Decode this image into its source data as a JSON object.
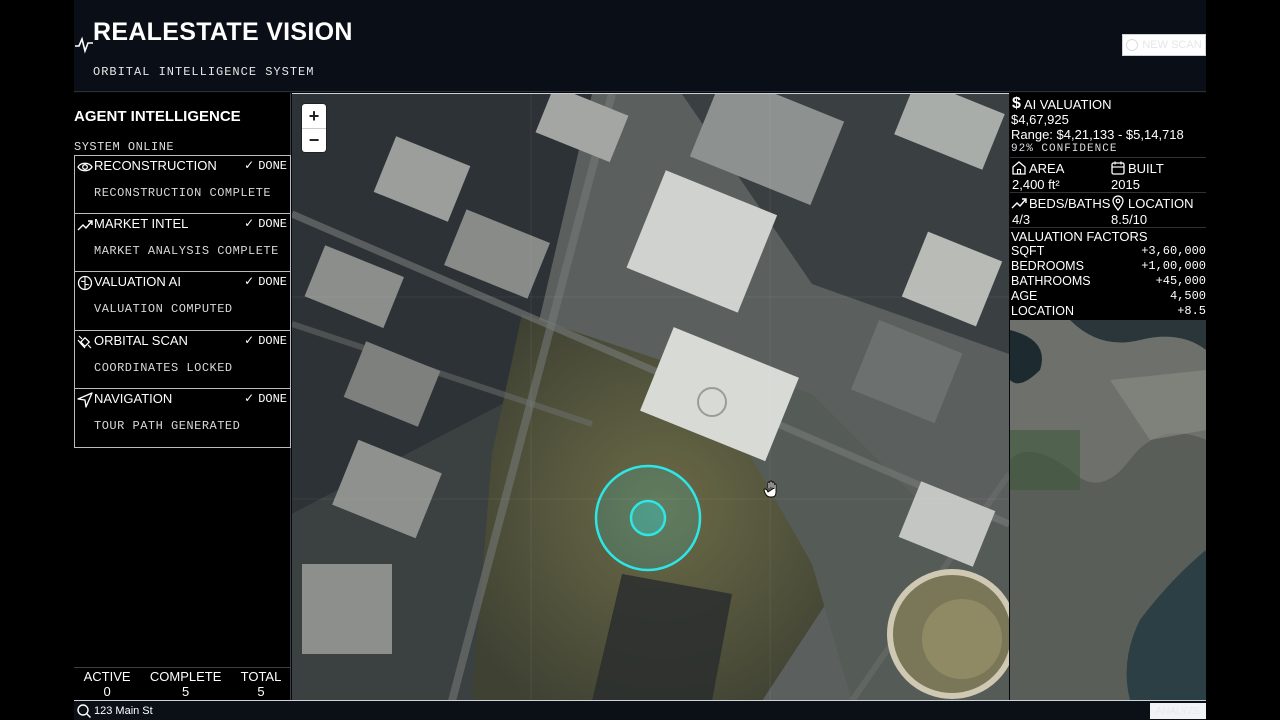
{
  "header": {
    "title": "REALESTATE VISION",
    "subtitle": "ORBITAL INTELLIGENCE SYSTEM",
    "new_scan_label": "NEW SCAN"
  },
  "left_panel": {
    "title": "AGENT INTELLIGENCE",
    "status": "SYSTEM ONLINE",
    "agents": [
      {
        "name": "RECONSTRUCTION",
        "icon": "eye-icon",
        "status": "DONE",
        "description": "RECONSTRUCTION COMPLETE"
      },
      {
        "name": "MARKET INTEL",
        "icon": "trending-up-icon",
        "status": "DONE",
        "description": "MARKET ANALYSIS COMPLETE"
      },
      {
        "name": "VALUATION AI",
        "icon": "brain-icon",
        "status": "DONE",
        "description": "VALUATION COMPUTED"
      },
      {
        "name": "ORBITAL SCAN",
        "icon": "satellite-icon",
        "status": "DONE",
        "description": "COORDINATES LOCKED"
      },
      {
        "name": "NAVIGATION",
        "icon": "navigation-icon",
        "status": "DONE",
        "description": "TOUR PATH GENERATED"
      }
    ],
    "check_glyph": "✓",
    "stats": [
      {
        "label": "ACTIVE",
        "value": "0"
      },
      {
        "label": "COMPLETE",
        "value": "5"
      },
      {
        "label": "TOTAL",
        "value": "5"
      }
    ]
  },
  "map": {
    "zoom_in": "+",
    "zoom_out": "−"
  },
  "valuation": {
    "title": "AI VALUATION",
    "price": "$4,67,925",
    "range": "Range: $4,21,133 - $5,14,718",
    "confidence": "92% CONFIDENCE",
    "area_label": "AREA",
    "area_value": "2,400 ft²",
    "built_label": "BUILT",
    "built_value": "2015",
    "beds_label": "BEDS/BATHS",
    "beds_value": "4/3",
    "location_label": "LOCATION",
    "location_value": "8.5/10",
    "factors_title": "VALUATION FACTORS",
    "factors": [
      {
        "name": "SQFT",
        "value": "+3,60,000"
      },
      {
        "name": "BEDROOMS",
        "value": "+1,00,000"
      },
      {
        "name": "BATHROOMS",
        "value": "+45,000"
      },
      {
        "name": "AGE",
        "value": "4,500"
      },
      {
        "name": "LOCATION",
        "value": "+8.5"
      }
    ]
  },
  "search": {
    "value": "123 Main St",
    "analyze_label": "ANALYZE"
  },
  "colors": {
    "accent_cyan": "#2ee6e6",
    "background": "#05070c"
  }
}
